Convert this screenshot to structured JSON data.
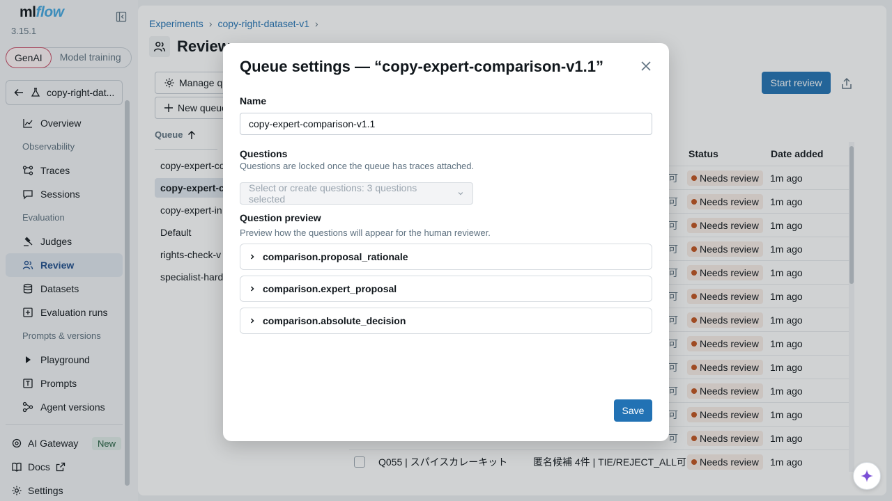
{
  "app": {
    "logo_ml": "ml",
    "logo_flow": "flow",
    "version": "3.15.1",
    "modes": [
      "GenAI",
      "Model training"
    ]
  },
  "sidebar": {
    "experiment": "copy-right-dat...",
    "items": [
      {
        "label": "Overview",
        "icon": "chart-line-icon"
      },
      {
        "section": "Observability"
      },
      {
        "label": "Traces",
        "icon": "traces-icon"
      },
      {
        "label": "Sessions",
        "icon": "chat-bubble-icon"
      },
      {
        "section": "Evaluation"
      },
      {
        "label": "Judges",
        "icon": "gavel-icon"
      },
      {
        "label": "Review",
        "icon": "users-icon",
        "active": true
      },
      {
        "label": "Datasets",
        "icon": "database-icon"
      },
      {
        "label": "Evaluation runs",
        "icon": "eval-runs-icon"
      },
      {
        "section": "Prompts & versions"
      },
      {
        "label": "Playground",
        "icon": "play-icon"
      },
      {
        "label": "Prompts",
        "icon": "prompt-icon"
      },
      {
        "label": "Agent versions",
        "icon": "agent-icon"
      }
    ],
    "bottom": {
      "gateway": "AI Gateway",
      "new_badge": "New",
      "docs": "Docs",
      "settings": "Settings"
    }
  },
  "main": {
    "breadcrumb": [
      "Experiments",
      "copy-right-dataset-v1"
    ],
    "title": "Review",
    "manage_queue": "Manage qu",
    "new_queue": "New queue",
    "start_review": "Start review",
    "queue_header": "Queue",
    "queues": [
      "copy-expert-co",
      "copy-expert-c",
      "copy-expert-in",
      "Default",
      "rights-check-v",
      "specialist-hard"
    ],
    "columns": {
      "status": "Status",
      "date": "Date added"
    },
    "rows": [
      {
        "trunc": "可",
        "status": "Needs review",
        "date": "1m ago"
      },
      {
        "trunc": "可",
        "status": "Needs review",
        "date": "1m ago"
      },
      {
        "trunc": "可",
        "status": "Needs review",
        "date": "1m ago"
      },
      {
        "trunc": "可",
        "status": "Needs review",
        "date": "1m ago"
      },
      {
        "trunc": "可",
        "status": "Needs review",
        "date": "1m ago"
      },
      {
        "trunc": "可",
        "status": "Needs review",
        "date": "1m ago"
      },
      {
        "trunc": "可",
        "status": "Needs review",
        "date": "1m ago"
      },
      {
        "trunc": "可",
        "status": "Needs review",
        "date": "1m ago"
      },
      {
        "trunc": "可",
        "status": "Needs review",
        "date": "1m ago"
      },
      {
        "trunc": "可",
        "status": "Needs review",
        "date": "1m ago"
      },
      {
        "trunc": "可",
        "status": "Needs review",
        "date": "1m ago"
      },
      {
        "trunc": "可",
        "status": "Needs review",
        "date": "1m ago"
      },
      {
        "title": "Q055 | スパイスカレーキット",
        "comp": "匿名候補 4件 | TIE/REJECT_ALL可",
        "status": "Needs review",
        "date": "1m ago"
      }
    ]
  },
  "modal": {
    "title": "Queue settings — “copy-expert-comparison-v1.1”",
    "name_label": "Name",
    "name_value": "copy-expert-comparison-v1.1",
    "questions_label": "Questions",
    "questions_hint": "Questions are locked once the queue has traces attached.",
    "questions_placeholder": "Select or create questions: 3 questions selected",
    "preview_label": "Question preview",
    "preview_hint": "Preview how the questions will appear for the human reviewer.",
    "preview_items": [
      "comparison.proposal_rationale",
      "comparison.expert_proposal",
      "comparison.absolute_decision"
    ],
    "save": "Save"
  },
  "colors": {
    "accent": "#2272b4",
    "status_dot": "#c0521e",
    "status_bg": "#f9ede7",
    "genai_border": "#c84a64"
  }
}
